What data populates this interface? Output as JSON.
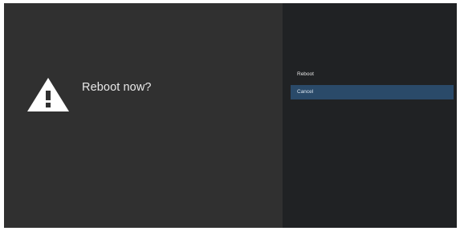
{
  "dialog": {
    "title": "Reboot now?",
    "icon": "warning-icon"
  },
  "menu": {
    "items": [
      {
        "label": "Reboot",
        "selected": false
      },
      {
        "label": "Cancel",
        "selected": true
      }
    ]
  },
  "colors": {
    "left_background": "#303030",
    "right_background": "#202224",
    "selected_item": "#2a4a69",
    "text": "#e8e8e8",
    "icon": "#ffffff"
  }
}
